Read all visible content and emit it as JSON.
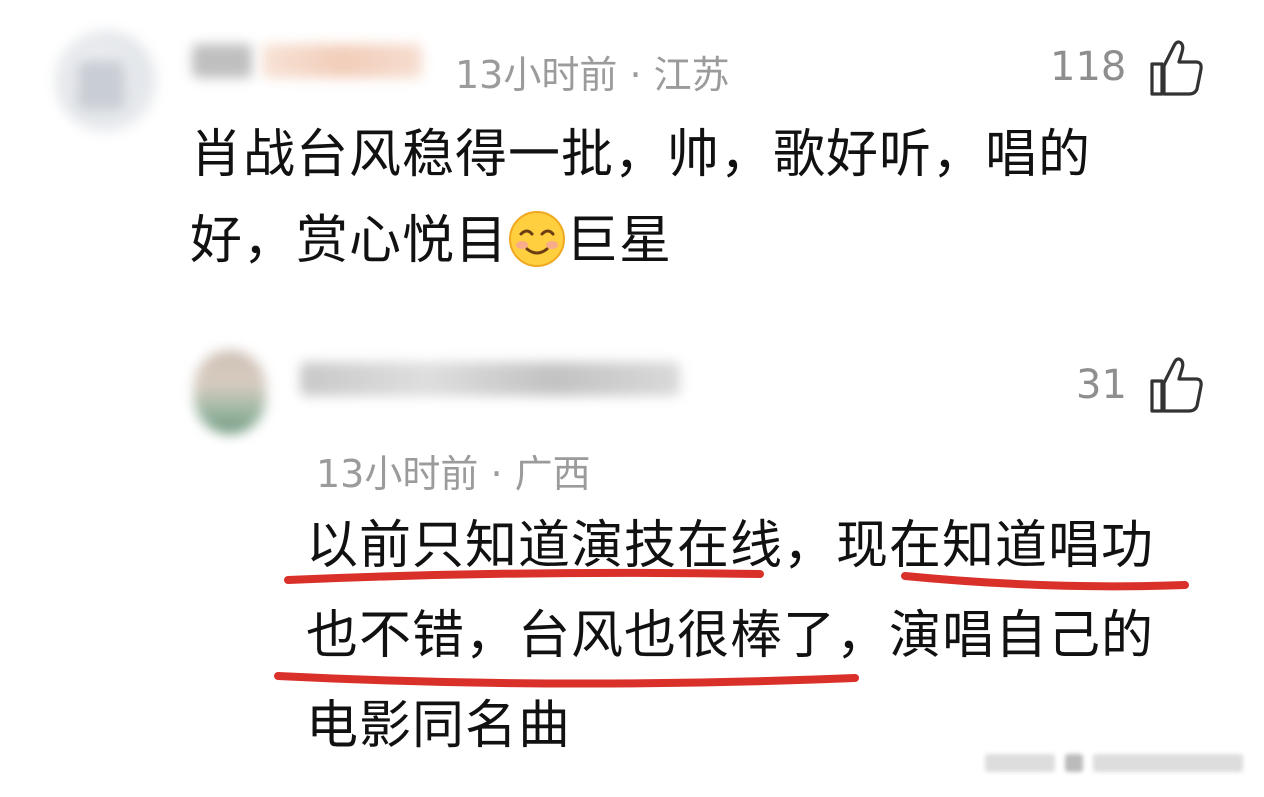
{
  "comment": {
    "time": "13小时前",
    "location": "江苏",
    "likes": "118",
    "text_line1": "肖战台风稳得一批，帅，歌好听，唱的",
    "text_line2a": "好，赏心悦目",
    "emoji": "smiling-face-icon",
    "text_line2b": "巨星"
  },
  "reply": {
    "likes": "31",
    "time": "13小时前",
    "location": "广西",
    "text_line1": "以前只知道演技在线，现在知道唱功",
    "text_line2": "也不错，台风也很棒了，演唱自己的",
    "text_line3": "电影同名曲"
  },
  "separator": " · ",
  "colors": {
    "underline": "#d9302a",
    "meta": "#9b9b9b",
    "text": "#111111"
  }
}
